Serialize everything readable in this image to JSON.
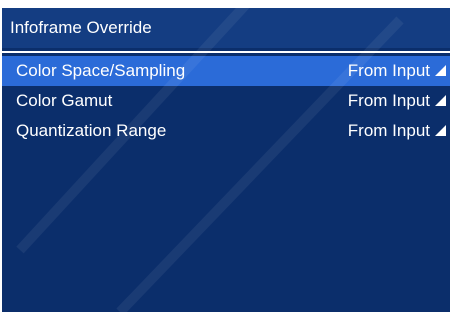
{
  "window": {
    "title": "Infoframe Override"
  },
  "menu": {
    "items": [
      {
        "label": "Color Space/Sampling",
        "value": "From Input",
        "selected": true
      },
      {
        "label": "Color Gamut",
        "value": "From Input",
        "selected": false
      },
      {
        "label": "Quantization Range",
        "value": "From Input",
        "selected": false
      }
    ]
  },
  "icons": {
    "dropdown": "dropdown-arrow-icon"
  },
  "colors": {
    "background": "#0b2e6b",
    "title_bar": "#143d82",
    "selection": "#2b6bd8",
    "text": "#ffffff"
  }
}
